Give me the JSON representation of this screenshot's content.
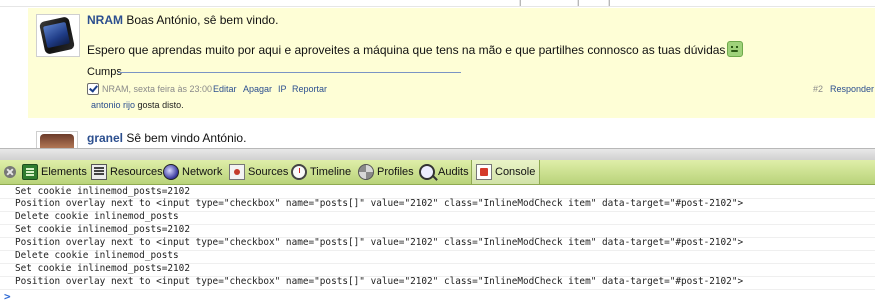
{
  "forum": {
    "top_ticks": [
      "|",
      "|",
      "|"
    ],
    "post1": {
      "username": "NRAM",
      "greeting": "Boas António, sê bem vindo.",
      "body": "Espero que aprendas muito por aqui e aproveites a máquina que tens na mão e que partilhes connosco as tuas dúvidas",
      "signature": "Cumps",
      "meta_time": "NRAM, sexta feira às 23:00",
      "actions": [
        "Editar",
        "Apagar",
        "IP",
        "Reportar"
      ],
      "post_number": "#2",
      "reply": "Responder",
      "liker": "antonio rijo",
      "liked_text": "gosta disto."
    },
    "post2": {
      "username": "granel",
      "greeting": "Sê bem vindo António."
    }
  },
  "devtools": {
    "tabs": [
      {
        "label": "Elements",
        "icon": "elements-icon"
      },
      {
        "label": "Resources",
        "icon": "resources-icon"
      },
      {
        "label": "Network",
        "icon": "network-icon"
      },
      {
        "label": "Sources",
        "icon": "sources-icon"
      },
      {
        "label": "Timeline",
        "icon": "timeline-icon"
      },
      {
        "label": "Profiles",
        "icon": "profiles-icon"
      },
      {
        "label": "Audits",
        "icon": "audits-icon"
      },
      {
        "label": "Console",
        "icon": "console-icon"
      }
    ],
    "selected_tab": "Console",
    "console_lines": [
      "Set cookie inlinemod_posts=2102",
      "Position overlay next to <input type=\"checkbox\" name=\"posts[]\" value=\"2102\" class=\"InlineModCheck item\" data-target=\"#post-2102\">",
      "Delete cookie inlinemod_posts",
      "Set cookie inlinemod_posts=2102",
      "Position overlay next to <input type=\"checkbox\" name=\"posts[]\" value=\"2102\" class=\"InlineModCheck item\" data-target=\"#post-2102\">",
      "Delete cookie inlinemod_posts",
      "Set cookie inlinemod_posts=2102",
      "Position overlay next to <input type=\"checkbox\" name=\"posts[]\" value=\"2102\" class=\"InlineModCheck item\" data-target=\"#post-2102\">"
    ],
    "prompt": ">"
  },
  "colors": {
    "toolbar": "#c9e08c",
    "post_highlight": "#fefed6",
    "username": "#2c4f8f"
  }
}
